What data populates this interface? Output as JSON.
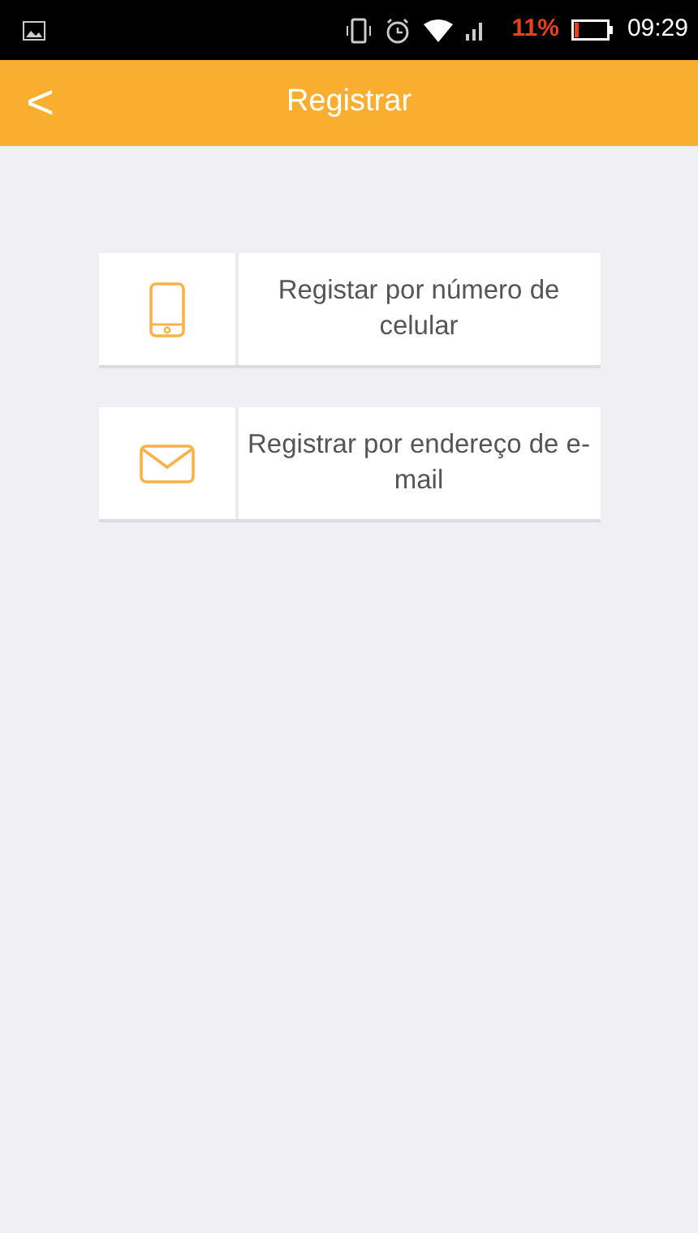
{
  "status_bar": {
    "battery_percent": "11%",
    "time": "09:29"
  },
  "header": {
    "back": "<",
    "title": "Registrar"
  },
  "options": [
    {
      "kind": "phone",
      "label": "Registar por número de celular"
    },
    {
      "kind": "email",
      "label": "Registrar por endereço de e-mail"
    }
  ]
}
